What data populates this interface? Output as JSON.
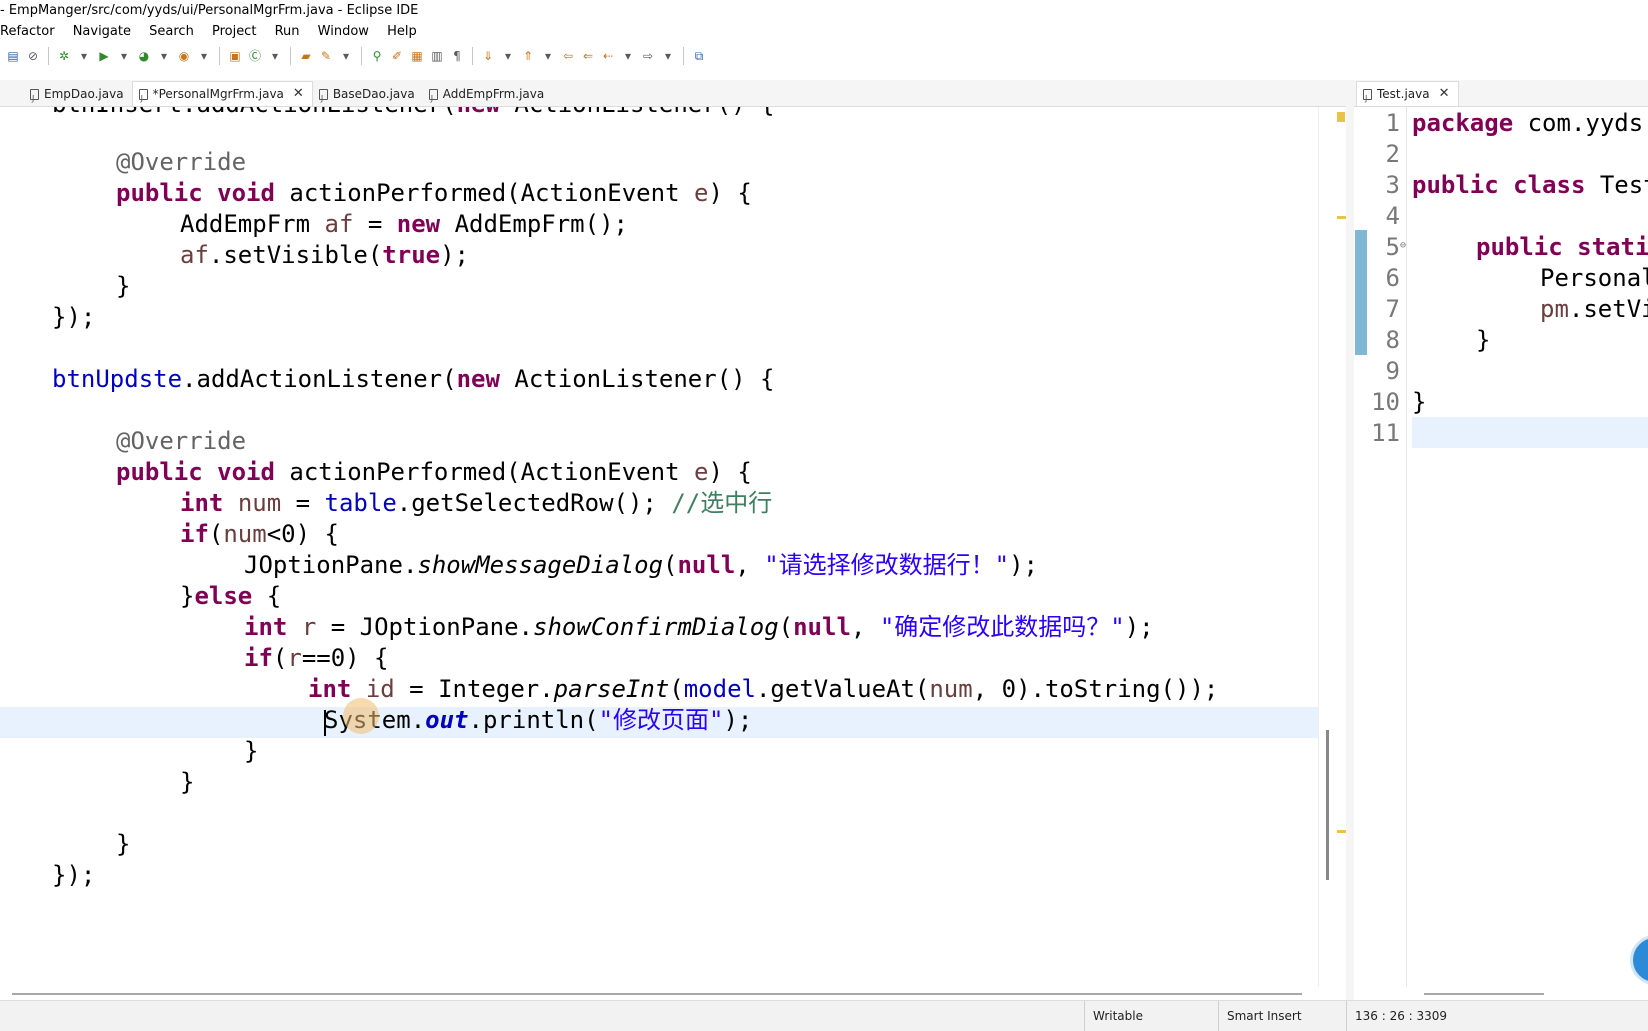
{
  "window": {
    "title": "- EmpManger/src/com/yyds/ui/PersonalMgrFrm.java - Eclipse IDE"
  },
  "menu": [
    "Refactor",
    "Navigate",
    "Search",
    "Project",
    "Run",
    "Window",
    "Help"
  ],
  "toolbar_icons": [
    "console-icon",
    "debug-icon",
    "run-icon",
    "coverage-icon",
    "external-tools-icon",
    "new-java-icon",
    "open-type-icon",
    "search-icon",
    "annotation-icon",
    "back-icon",
    "forward-icon",
    "pin-icon"
  ],
  "editor_tabs": [
    {
      "label": "EmpDao.java",
      "active": false
    },
    {
      "label": "*PersonalMgrFrm.java",
      "active": true
    },
    {
      "label": "BaseDao.java",
      "active": false
    },
    {
      "label": "AddEmpFrm.java",
      "active": false
    }
  ],
  "right_tabs": [
    {
      "label": "Test.java",
      "active": true
    }
  ],
  "code_strings": {
    "comment_selected": "//选中行",
    "msg_select": "\"请选择修改数据行！\"",
    "msg_confirm": "\"确定修改此数据吗？\"",
    "msg_page": "\"修改页面\""
  },
  "right_editor": {
    "line_numbers": [
      "1",
      "2",
      "3",
      "4",
      "5",
      "6",
      "7",
      "8",
      "9",
      "10",
      "11"
    ]
  },
  "status": {
    "writable": "Writable",
    "insert_mode": "Smart Insert",
    "position": "136 : 26 : 3309"
  },
  "colors": {
    "keyword": "#7f0055",
    "string": "#2a00ff",
    "comment": "#3f7f5f",
    "annotation": "#646464",
    "field": "#0000c0",
    "current_line": "#e8f2fe"
  }
}
